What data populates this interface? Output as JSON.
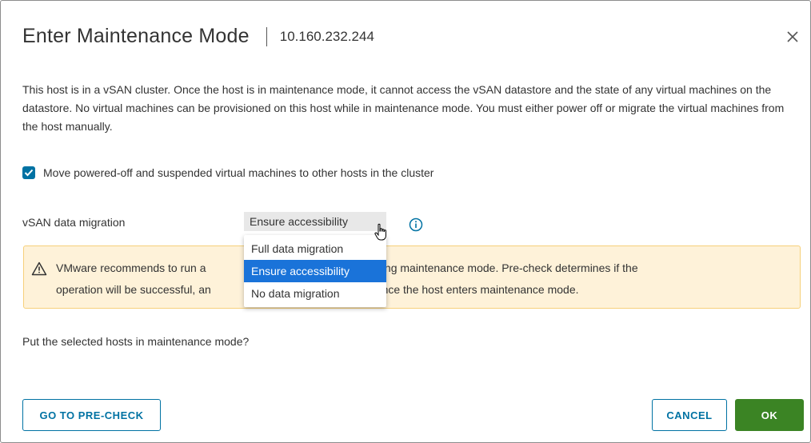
{
  "dialog": {
    "title": "Enter Maintenance Mode",
    "host": "10.160.232.244",
    "description": "This host is in a vSAN cluster. Once the host is in maintenance mode, it cannot access the vSAN datastore and the state of any virtual machines on the datastore. No virtual machines can be provisioned on this host while in maintenance mode. You must either power off or migrate the virtual machines from the host manually.",
    "move_vms": {
      "label": "Move powered-off and suspended virtual machines to other hosts in the cluster",
      "checked": true
    },
    "vsan_migration": {
      "label": "vSAN data migration",
      "selected": "Ensure accessibility",
      "options": [
        "Full data migration",
        "Ensure accessibility",
        "No data migration"
      ]
    },
    "alert": {
      "line1_start": "VMware recommends to run a ",
      "line1_end": " before entering maintenance mode. Pre-check determines if the",
      "line2_start": "operation will be successful, an",
      "line2_end": " cluster once the host enters maintenance mode."
    },
    "question": "Put the selected hosts in maintenance mode?",
    "buttons": {
      "precheck": "GO TO PRE-CHECK",
      "cancel": "CANCEL",
      "ok": "OK"
    }
  },
  "colors": {
    "primary_blue": "#0072a3",
    "ok_green": "#3b8424",
    "selected_option": "#1a73d9",
    "alert_bg": "#fef2d9",
    "alert_border": "#f6d07a"
  },
  "icons": [
    "close-icon",
    "checkmark-icon",
    "info-icon",
    "warning-icon",
    "hand-cursor-icon"
  ]
}
